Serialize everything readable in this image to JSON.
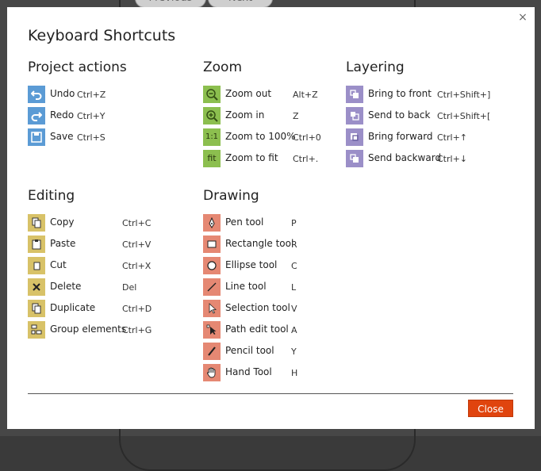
{
  "background": {
    "prev_label": "Previous",
    "next_label": "Next"
  },
  "dialog": {
    "title": "Keyboard Shortcuts",
    "close_x": "×",
    "close_button": "Close"
  },
  "sections": {
    "project": {
      "title": "Project actions",
      "items": [
        {
          "label": "Undo",
          "key": "Ctrl+Z",
          "icon": "undo-icon"
        },
        {
          "label": "Redo",
          "key": "Ctrl+Y",
          "icon": "redo-icon"
        },
        {
          "label": "Save",
          "key": "Ctrl+S",
          "icon": "save-icon"
        }
      ]
    },
    "zoom": {
      "title": "Zoom",
      "items": [
        {
          "label": "Zoom out",
          "key": "Alt+Z",
          "icon": "zoom-out-icon"
        },
        {
          "label": "Zoom in",
          "key": "Z",
          "icon": "zoom-in-icon"
        },
        {
          "label": "Zoom to 100%",
          "key": "Ctrl+0",
          "icon": "1:1"
        },
        {
          "label": "Zoom to fit",
          "key": "Ctrl+.",
          "icon": "fit"
        }
      ]
    },
    "layering": {
      "title": "Layering",
      "items": [
        {
          "label": "Bring to front",
          "key": "Ctrl+Shift+]",
          "icon": "bring-to-front-icon"
        },
        {
          "label": "Send to back",
          "key": "Ctrl+Shift+[",
          "icon": "send-to-back-icon"
        },
        {
          "label": "Bring forward",
          "key": "Ctrl+↑",
          "icon": "bring-forward-icon"
        },
        {
          "label": "Send backward",
          "key": "Ctrl+↓",
          "icon": "send-backward-icon"
        }
      ]
    },
    "editing": {
      "title": "Editing",
      "items": [
        {
          "label": "Copy",
          "key": "Ctrl+C",
          "icon": "copy-icon"
        },
        {
          "label": "Paste",
          "key": "Ctrl+V",
          "icon": "paste-icon"
        },
        {
          "label": "Cut",
          "key": "Ctrl+X",
          "icon": "cut-icon"
        },
        {
          "label": "Delete",
          "key": "Del",
          "icon": "delete-icon"
        },
        {
          "label": "Duplicate",
          "key": "Ctrl+D",
          "icon": "duplicate-icon"
        },
        {
          "label": "Group elements",
          "key": "Ctrl+G",
          "icon": "group-icon"
        }
      ]
    },
    "drawing": {
      "title": "Drawing",
      "items": [
        {
          "label": "Pen tool",
          "key": "P",
          "icon": "pen-tool-icon"
        },
        {
          "label": "Rectangle tool",
          "key": "R",
          "icon": "rectangle-tool-icon"
        },
        {
          "label": "Ellipse tool",
          "key": "C",
          "icon": "ellipse-tool-icon"
        },
        {
          "label": "Line tool",
          "key": "L",
          "icon": "line-tool-icon"
        },
        {
          "label": "Selection tool",
          "key": "V",
          "icon": "selection-tool-icon"
        },
        {
          "label": "Path edit tool",
          "key": "A",
          "icon": "path-edit-tool-icon"
        },
        {
          "label": "Pencil tool",
          "key": "Y",
          "icon": "pencil-tool-icon"
        },
        {
          "label": "Hand Tool",
          "key": "H",
          "icon": "hand-tool-icon"
        }
      ]
    }
  },
  "colors": {
    "project": "#5b9bd5",
    "zoom": "#8cbf4f",
    "layering": "#9b8fc8",
    "editing": "#d8c268",
    "drawing": "#e58873",
    "close_button": "#e0440e"
  }
}
